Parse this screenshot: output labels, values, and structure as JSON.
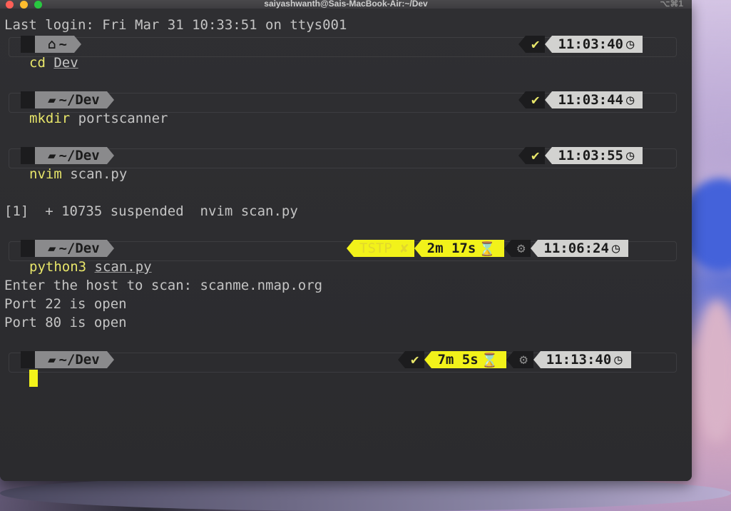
{
  "window": {
    "title": "saiyashwanth@Sais-MacBook-Air:~/Dev",
    "shortcut": "⌥⌘1"
  },
  "terminal": {
    "last_login": "Last login: Fri Mar 31 10:33:51 on ttys001",
    "prompts": [
      {
        "dir": "~",
        "dir_icon": "home-icon",
        "command": "cd",
        "arg": "Dev",
        "status": "✔",
        "time": "11:03:40"
      },
      {
        "dir": "~/Dev",
        "dir_icon": "folder-icon",
        "command": "mkdir",
        "arg": "portscanner",
        "status": "✔",
        "time": "11:03:44"
      },
      {
        "dir": "~/Dev",
        "dir_icon": "folder-icon",
        "command": "nvim",
        "arg": "scan.py",
        "status": "✔",
        "time": "11:03:55"
      },
      {
        "dir": "~/Dev",
        "dir_icon": "folder-icon",
        "command": "python3",
        "arg": "scan.py",
        "status": "TSTP ✘",
        "duration": "2m 17s",
        "time": "11:06:24"
      },
      {
        "dir": "~/Dev",
        "dir_icon": "folder-icon",
        "command": "",
        "arg": "",
        "status": "✔",
        "duration": "7m 5s",
        "time": "11:13:40"
      }
    ],
    "output": {
      "suspended": "[1]  + 10735 suspended  nvim scan.py",
      "host_prompt": "Enter the host to scan: scanme.nmap.org",
      "port22": "Port 22 is open",
      "port80": "Port 80 is open"
    }
  }
}
